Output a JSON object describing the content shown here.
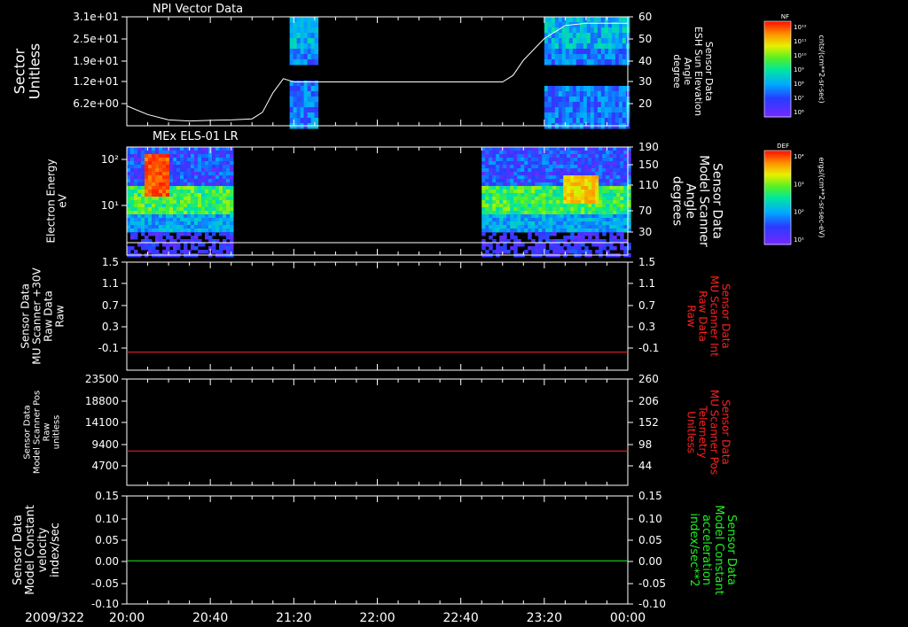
{
  "colors": {
    "background": "#000000",
    "axis": "#ffffff",
    "red_trace": "#ff2020",
    "green_trace": "#22ee22",
    "label_white": "#ffffff",
    "label_red": "#ff2020",
    "label_green": "#22ee22"
  },
  "time_axis": {
    "date_label": "2009/322",
    "ticks": [
      "20:00",
      "20:40",
      "21:20",
      "22:00",
      "22:40",
      "23:20",
      "00:00"
    ]
  },
  "chart_data": [
    {
      "type": "heatmap",
      "title": "NPI Vector Data",
      "ylabel_left": [
        "Sector",
        "Unitless"
      ],
      "left_ticks": [
        "3.1e+01",
        "2.5e+01",
        "1.9e+01",
        "1.2e+01",
        "6.2e+00"
      ],
      "ylabel_right": [
        "Sensor Data",
        "ESH Sun Elevation",
        "Angle",
        "degree"
      ],
      "right_ticks": [
        "60",
        "50",
        "40",
        "30",
        "20"
      ],
      "right_ylim": [
        10,
        60
      ],
      "overlay_line": {
        "name": "ESH Sun Elevation Angle",
        "x_minutes": [
          0,
          10,
          20,
          30,
          40,
          50,
          60,
          65,
          70,
          75,
          80,
          90,
          100,
          120,
          140,
          160,
          170,
          180,
          185,
          190,
          200,
          210,
          220,
          230,
          240
        ],
        "y": [
          19,
          15,
          12.5,
          12,
          12.3,
          12.5,
          13,
          16,
          25,
          31.5,
          30,
          30,
          30,
          30,
          30,
          30,
          30,
          30,
          33,
          40,
          50,
          56,
          57,
          57,
          57
        ]
      },
      "data_blocks": [
        {
          "from": "21:18",
          "to": "21:30"
        },
        {
          "from": "23:20",
          "to": "00:00"
        }
      ],
      "colorbar": {
        "label": "NF",
        "units": "cnts/(cm**2-sr-sec)",
        "ticks": [
          "10¹²",
          "10¹¹",
          "10¹⁰",
          "10⁹",
          "10⁸",
          "10⁷",
          "10⁶"
        ]
      }
    },
    {
      "type": "heatmap",
      "title": "MEx ELS-01 LR",
      "ylabel_left": [
        "Electron Energy",
        "eV"
      ],
      "left_ticks": [
        "10²",
        "10¹"
      ],
      "ylabel_right": [
        "Sensor Data",
        "Model Scanner",
        "Angle",
        "degrees"
      ],
      "right_ticks": [
        "190",
        "150",
        "110",
        "70",
        "30"
      ],
      "data_blocks": [
        {
          "from": "20:00",
          "to": "20:50"
        },
        {
          "from": "22:50",
          "to": "00:00"
        }
      ],
      "colorbar": {
        "label": "DEF",
        "units": "ergs/(cm**2-sr-sec-eV)",
        "ticks": [
          "10⁴",
          "10³",
          "10²",
          "10¹"
        ]
      }
    },
    {
      "type": "line",
      "ylabel_left": [
        "Sensor Data",
        "MU Scanner +30V",
        "Raw Data",
        "Raw"
      ],
      "left_ticks": [
        "1.5",
        "1.1",
        "0.7",
        "0.3",
        "-0.1"
      ],
      "left_ylim": [
        -0.3,
        1.5
      ],
      "ylabel_right": [
        "Sensor Data",
        "MU Scanner Int",
        "Raw Data",
        "Raw"
      ],
      "right_ticks": [
        "1.5",
        "1.1",
        "0.7",
        "0.3",
        "-0.1"
      ],
      "series": [
        {
          "color": "red",
          "values": [
            0.0,
            0.0
          ]
        }
      ]
    },
    {
      "type": "line",
      "ylabel_left": [
        "Sensor Data",
        "Model Scanner Pos",
        "Raw",
        "unitless"
      ],
      "left_ticks": [
        "23500",
        "18800",
        "14100",
        "9400",
        "4700"
      ],
      "left_ylim": [
        0,
        23500
      ],
      "ylabel_right": [
        "Sensor Data",
        "MU Scanner Pos",
        "Telemetry",
        "Unitless"
      ],
      "right_ticks": [
        "260",
        "206",
        "152",
        "98",
        "44"
      ],
      "series": [
        {
          "color": "red",
          "values": [
            7600,
            7600
          ]
        }
      ]
    },
    {
      "type": "line",
      "ylabel_left": [
        "Sensor Data",
        "Model Constant",
        "velocity",
        "index/sec"
      ],
      "left_ticks": [
        "0.15",
        "0.10",
        "0.05",
        "0.00",
        "-0.05",
        "-0.10"
      ],
      "left_ylim": [
        -0.1,
        0.15
      ],
      "ylabel_right": [
        "Sensor Data",
        "Model Constant",
        "acceleration",
        "index/sec**2"
      ],
      "right_ticks": [
        "0.15",
        "0.10",
        "0.05",
        "0.00",
        "-0.05",
        "-0.10"
      ],
      "series": [
        {
          "color": "green",
          "values": [
            0.0,
            0.0
          ]
        }
      ]
    }
  ]
}
